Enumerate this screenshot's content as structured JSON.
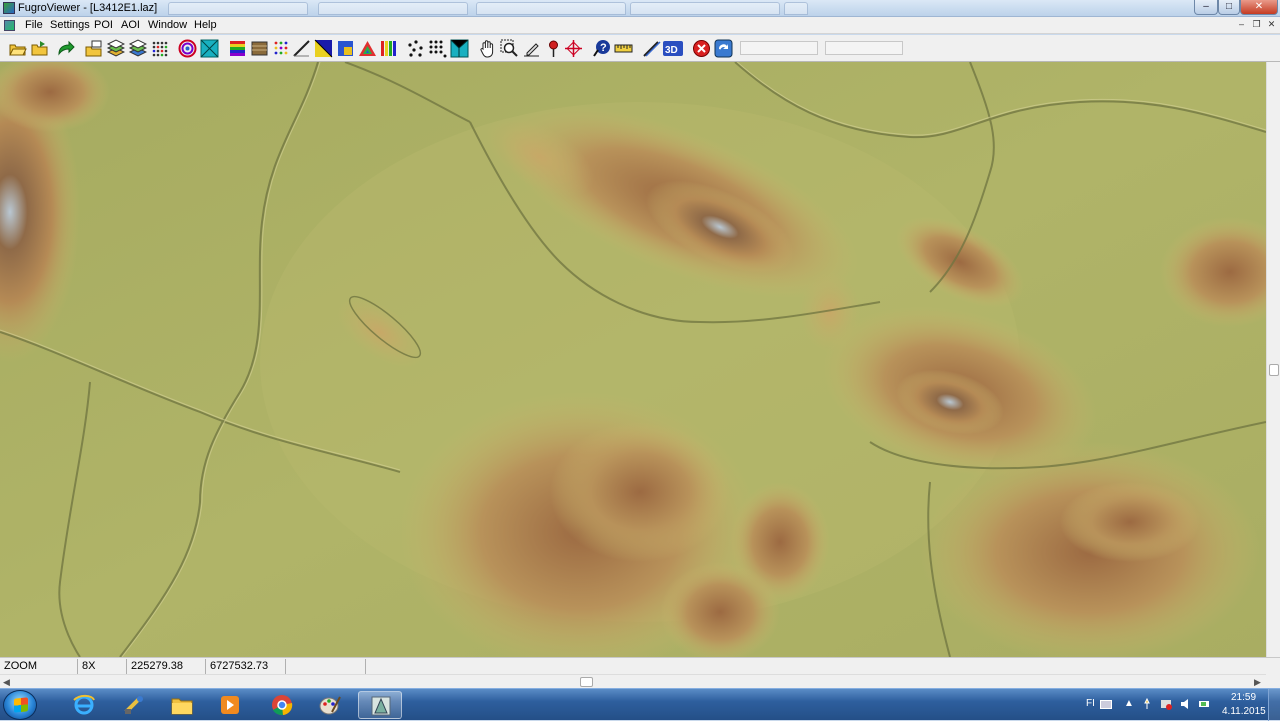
{
  "window": {
    "title": "FugroViewer - [L3412E1.laz]"
  },
  "menu": {
    "items": [
      "File",
      "Settings",
      "POI",
      "AOI",
      "Window",
      "Help"
    ]
  },
  "toolbar": {
    "icons": [
      "open-file",
      "open-folder",
      "redo",
      "open-layers",
      "stack-layers",
      "stack-layers-alt",
      "grid-points",
      "color-spiral",
      "tin-surface",
      "color-ramp",
      "brown-ramp",
      "dots-grid",
      "profile-line",
      "diagonal-color",
      "blue-square",
      "triangle-color",
      "rainbow-bars",
      "scatter-dots",
      "point-cloud",
      "tin-cyan",
      "pan-hand",
      "zoom-window",
      "edit-pencil",
      "poi-pin",
      "crosshair",
      "help-query",
      "measure-ruler",
      "draw-line",
      "view-3d",
      "stop",
      "refresh"
    ],
    "fields": [
      "",
      ""
    ]
  },
  "statusbar": {
    "mode": "ZOOM",
    "zoom": "8X",
    "x_coord": "225279.38",
    "y_coord": "6727532.73",
    "extra1": "",
    "extra2": ""
  },
  "taskbar": {
    "apps": [
      "internet-explorer",
      "control-panel",
      "file-explorer",
      "media-player",
      "chrome",
      "paint",
      "fugroviewer"
    ],
    "active_app": "fugroviewer",
    "lang": "FI",
    "time": "21:59",
    "date": "4.11.2015"
  },
  "colors": {
    "terrain_low": "#a9b062",
    "terrain_mid": "#c8b266",
    "terrain_high": "#9c6a3e",
    "terrain_peak": "#b4c6d2",
    "title_bg": "#c9d9ec",
    "taskbar_bg": "#2e5f9e"
  }
}
